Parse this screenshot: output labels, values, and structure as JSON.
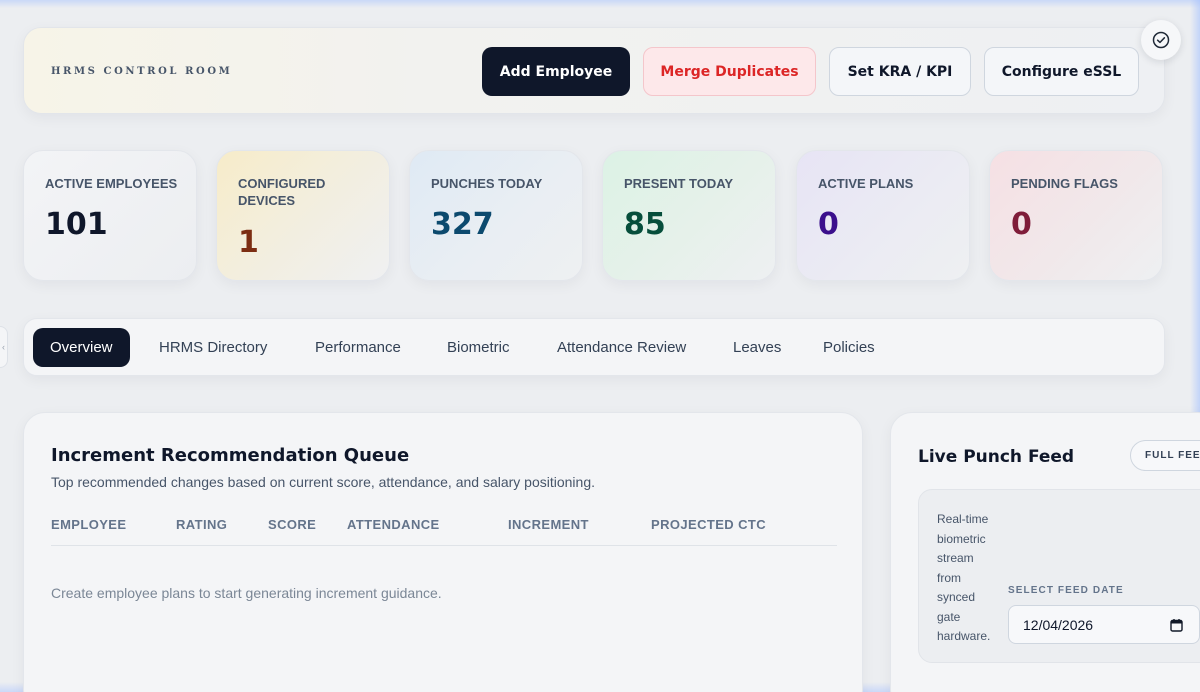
{
  "header": {
    "brand": "HRMS CONTROL ROOM",
    "buttons": {
      "add_employee": "Add Employee",
      "merge_duplicates": "Merge Duplicates",
      "set_kra_kpi": "Set KRA / KPI",
      "configure_essl": "Configure eSSL"
    }
  },
  "stats": [
    {
      "label": "ACTIVE EMPLOYEES",
      "value": "101"
    },
    {
      "label": "CONFIGURED DEVICES",
      "value": "1"
    },
    {
      "label": "PUNCHES TODAY",
      "value": "327"
    },
    {
      "label": "PRESENT TODAY",
      "value": "85"
    },
    {
      "label": "ACTIVE PLANS",
      "value": "0"
    },
    {
      "label": "PENDING FLAGS",
      "value": "0"
    }
  ],
  "tabs": [
    {
      "label": "Overview",
      "active": true
    },
    {
      "label": "HRMS Directory"
    },
    {
      "label": "Performance"
    },
    {
      "label": "Biometric"
    },
    {
      "label": "Attendance Review"
    },
    {
      "label": "Leaves"
    },
    {
      "label": "Policies"
    }
  ],
  "increment_queue": {
    "title": "Increment Recommendation Queue",
    "subtitle": "Top recommended changes based on current score, attendance, and salary positioning.",
    "columns": [
      "EMPLOYEE",
      "RATING",
      "SCORE",
      "ATTENDANCE",
      "INCREMENT",
      "PROJECTED CTC"
    ],
    "empty_message": "Create employee plans to start generating increment guidance."
  },
  "live_feed": {
    "title": "Live Punch Feed",
    "full_feed_label": "FULL FEED",
    "description": "Real-time biometric stream from synced gate hardware.",
    "date_label": "SELECT FEED DATE",
    "date_value": "12/04/2026"
  },
  "colors": {
    "primary_dark": "#0f172a",
    "danger": "#dc2626",
    "background": "#eceef1"
  },
  "icons": {
    "corner": "check-circle-icon",
    "date_picker": "calendar-icon",
    "side_handle": "chevron-left-icon"
  }
}
